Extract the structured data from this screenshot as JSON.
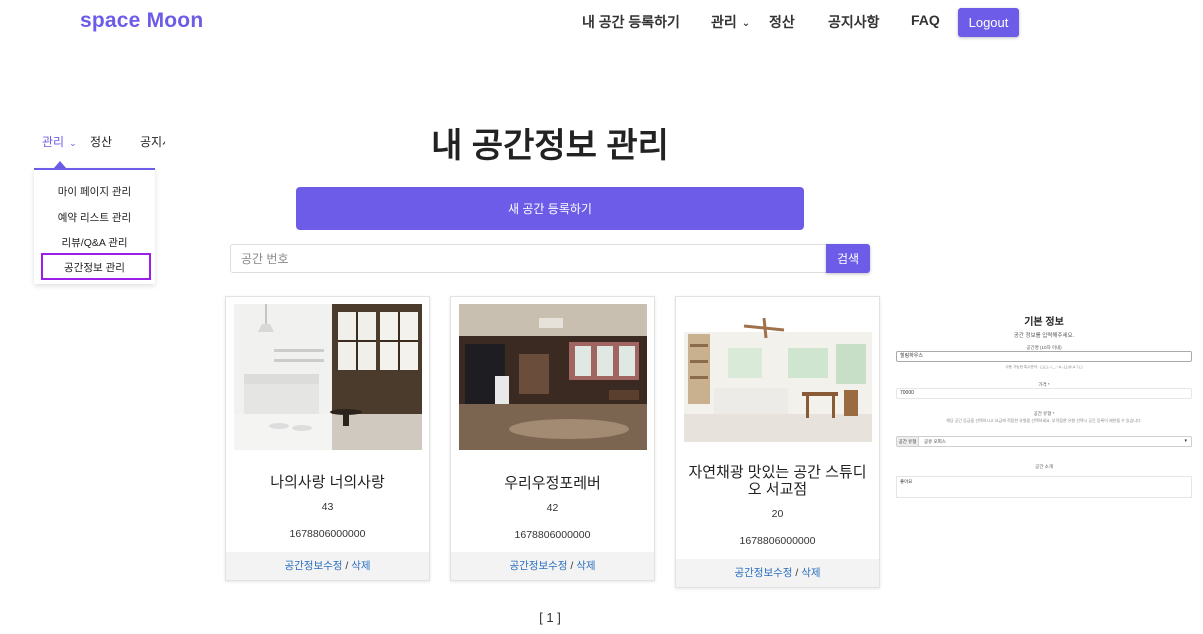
{
  "header": {
    "brand": "space Moon",
    "nav": {
      "register": "내 공간 등록하기",
      "manage": "관리",
      "settle": "정산",
      "notice": "공지사항",
      "faq": "FAQ"
    },
    "logout_label": "Logout"
  },
  "sub_nav": {
    "manage": "관리",
    "settle": "정산",
    "notice": "공지사항",
    "dropdown": [
      "마이 페이지 관리",
      "예약 리스트 관리",
      "리뷰/Q&A 관리",
      "공간정보 관리"
    ],
    "selected_index": 3
  },
  "main": {
    "title": "내 공간정보 관리",
    "new_button_label": "새 공간 등록하기",
    "search": {
      "placeholder": "공간 번호",
      "value": "",
      "button_label": "검색"
    },
    "cards": [
      {
        "name": "나의사랑 너의사랑",
        "id": "43",
        "phone": "1678806000000",
        "edit_label": "공간정보수정",
        "sep": " / ",
        "delete_label": "삭제"
      },
      {
        "name": "우리우정포레버",
        "id": "42",
        "phone": "1678806000000",
        "edit_label": "공간정보수정",
        "sep": " / ",
        "delete_label": "삭제"
      },
      {
        "name": "자연채광 맛있는 공간 스튜디오 서교점",
        "id": "20",
        "phone": "1678806000000",
        "edit_label": "공간정보수정",
        "sep": " / ",
        "delete_label": "삭제"
      }
    ],
    "pagination": "[ 1 ]"
  },
  "mini_form": {
    "title": "기본 정보",
    "subtitle": "공간 정보를 입력해주세요.",
    "space_name_label": "공간명 (10자 이내)",
    "space_name_value": "힐링하우스",
    "space_name_hint": "사용 가능한 특수문자 : (,),[,],-,/,_,~,&,:,[,],@,&,?,(,)",
    "price_label": "가격 *",
    "price_value": "70000",
    "type_label": "공간 유형 *",
    "type_hint": "해당 공간 등급을 선택하시고 요금에 적합한 유형을 선택하세요. 부적합한 유형 선택시 공간 등록이 제한될 수 있습니다.",
    "type_select_label": "공간 유형",
    "type_select_value": "공유 오피스",
    "intro_label": "공간 소개",
    "intro_value": "좋아요"
  }
}
